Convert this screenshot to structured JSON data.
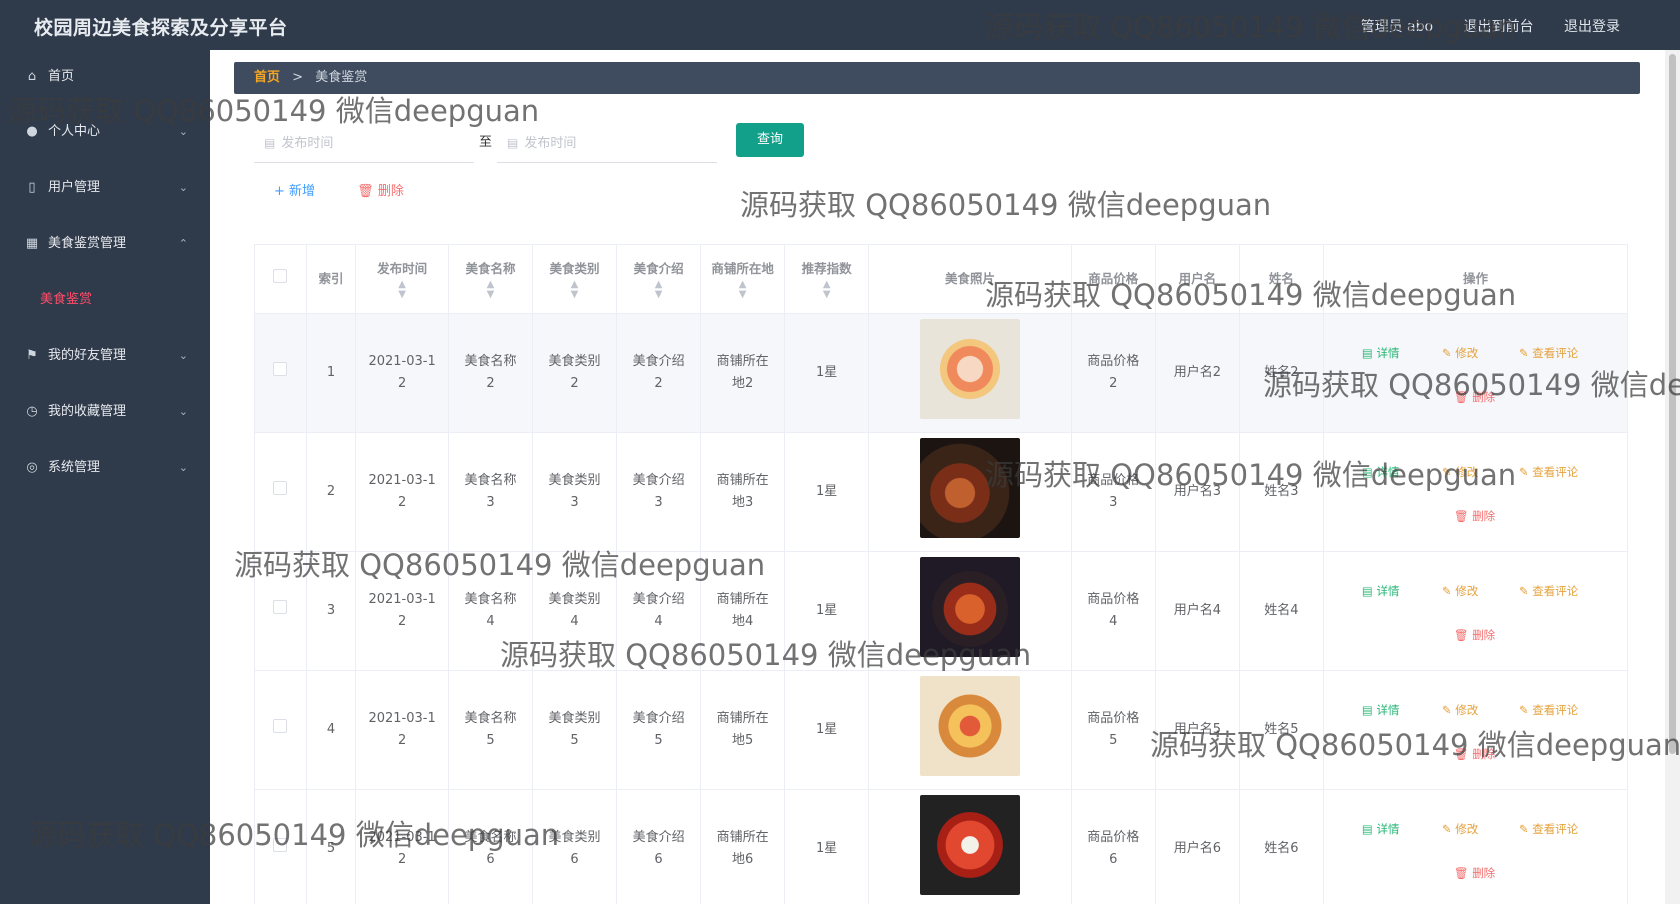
{
  "app": {
    "title": "校园周边美食探索及分享平台"
  },
  "header": {
    "user": "管理员 abo",
    "back_label": "退出到前台",
    "logout_label": "退出登录"
  },
  "sidebar": {
    "items": [
      {
        "label": "首页",
        "icon": "home-icon"
      },
      {
        "label": "个人中心",
        "icon": "user-icon"
      },
      {
        "label": "用户管理",
        "icon": "phone-icon"
      },
      {
        "label": "美食鉴赏管理",
        "icon": "grid-icon"
      },
      {
        "label": "美食鉴赏",
        "icon": ""
      },
      {
        "label": "我的好友管理",
        "icon": "flag-icon"
      },
      {
        "label": "我的收藏管理",
        "icon": "clock-icon"
      },
      {
        "label": "系统管理",
        "icon": "compass-icon"
      }
    ]
  },
  "breadcrumb": {
    "home": "首页",
    "separator": ">",
    "current": "美食鉴赏"
  },
  "search": {
    "start_placeholder": "发布时间",
    "separator": "至",
    "end_placeholder": "发布时间",
    "query_label": "查询"
  },
  "actions": {
    "add_label": "+ 新增",
    "delete_label": "删除"
  },
  "table": {
    "columns": [
      "索引",
      "发布时间",
      "美食名称",
      "美食类别",
      "美食介绍",
      "商铺所在地",
      "推荐指数",
      "美食照片",
      "商品价格",
      "用户名",
      "姓名",
      "操作"
    ],
    "rows": [
      {
        "index": "1",
        "time": "2021-03-12",
        "name": "美食名称2",
        "category": "美食类别2",
        "intro": "美食介绍2",
        "location": "商铺所在地2",
        "rating": "1星",
        "price": "商品价格2",
        "username": "用户名2",
        "realname": "姓名2"
      },
      {
        "index": "2",
        "time": "2021-03-12",
        "name": "美食名称3",
        "category": "美食类别3",
        "intro": "美食介绍3",
        "location": "商铺所在地3",
        "rating": "1星",
        "price": "商品价格3",
        "username": "用户名3",
        "realname": "姓名3"
      },
      {
        "index": "3",
        "time": "2021-03-12",
        "name": "美食名称4",
        "category": "美食类别4",
        "intro": "美食介绍4",
        "location": "商铺所在地4",
        "rating": "1星",
        "price": "商品价格4",
        "username": "用户名4",
        "realname": "姓名4"
      },
      {
        "index": "4",
        "time": "2021-03-12",
        "name": "美食名称5",
        "category": "美食类别5",
        "intro": "美食介绍5",
        "location": "商铺所在地5",
        "rating": "1星",
        "price": "商品价格5",
        "username": "用户名5",
        "realname": "姓名5"
      },
      {
        "index": "5",
        "time": "2021-03-12",
        "name": "美食名称6",
        "category": "美食类别6",
        "intro": "美食介绍6",
        "location": "商铺所在地6",
        "rating": "1星",
        "price": "商品价格6",
        "username": "用户名6",
        "realname": "姓名6"
      }
    ],
    "ops": {
      "detail": "详情",
      "edit": "修改",
      "comment": "查看评论",
      "delete": "删除"
    }
  },
  "watermark": "源码获取 QQ86050149 微信deepguan",
  "colors": {
    "header_bg": "#2f3a4a",
    "sidebar_bg": "#2f3a4a",
    "accent": "#12a08a",
    "active_menu": "#ff4d6a",
    "breadcrumb_home": "#f5a623"
  }
}
